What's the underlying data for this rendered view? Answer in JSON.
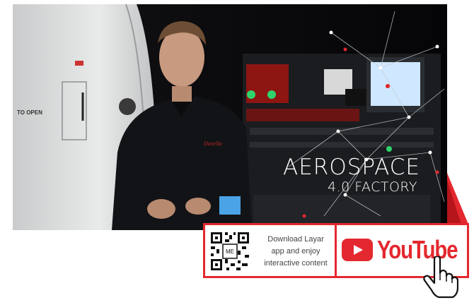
{
  "video": {
    "title_line1": "AEROSPACE",
    "title_line2": "4.0 FACTORY",
    "panel_label": "TO OPEN",
    "shirt_logo": "Danella"
  },
  "promo": {
    "qr_label": "ME",
    "text_lines": [
      "Download Layar",
      "app and enjoy",
      "interactive content"
    ],
    "youtube_label": "YouTube",
    "accent_color": "#e4282f",
    "icons": [
      "qr-code-icon",
      "youtube-play-icon",
      "hand-pointer-icon"
    ]
  }
}
